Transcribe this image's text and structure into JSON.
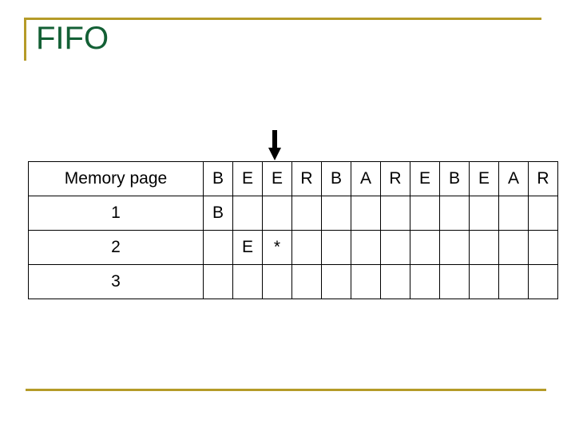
{
  "slide": {
    "title": "FIFO",
    "accent_color": "#b59b28",
    "title_color": "#136035"
  },
  "table": {
    "header_label": "Memory page",
    "reference_string": [
      "B",
      "E",
      "E",
      "R",
      "B",
      "A",
      "R",
      "E",
      "B",
      "E",
      "A",
      "R"
    ],
    "frames": [
      {
        "label": "1",
        "cells": [
          "B",
          "",
          "",
          "",
          "",
          "",
          "",
          "",
          "",
          "",
          "",
          ""
        ]
      },
      {
        "label": "2",
        "cells": [
          "",
          "E",
          "*",
          "",
          "",
          "",
          "",
          "",
          "",
          "",
          "",
          ""
        ]
      },
      {
        "label": "3",
        "cells": [
          "",
          "",
          "",
          "",
          "",
          "",
          "",
          "",
          "",
          "",
          "",
          ""
        ]
      }
    ],
    "page_color": "#cc77dd",
    "fault_color": "#b01f24",
    "fault_marker": "*"
  },
  "pointer": {
    "icon": "down-arrow-icon",
    "target_column_index": 2,
    "color": "#000000"
  }
}
